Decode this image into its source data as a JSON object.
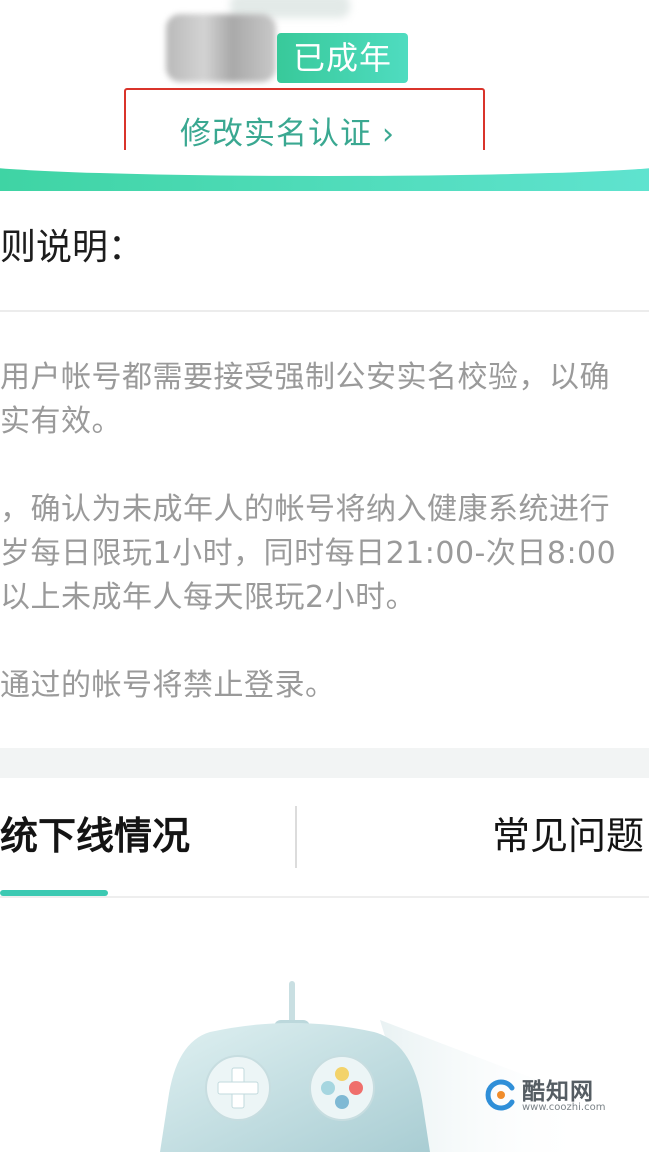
{
  "header": {
    "status_badge": "已成年",
    "modify_link": "修改实名认证",
    "modify_chevron": "›"
  },
  "rules": {
    "heading": "则说明：",
    "lines": [
      "用户帐号都需要接受强制公安实名校验，以确",
      "实有效。",
      "，确认为未成年人的帐号将纳入健康系统进行",
      "岁每日限玩1小时，同时每日21:00-次日8:00",
      "以上未成年人每天限玩2小时。",
      "通过的帐号将禁止登录。"
    ]
  },
  "tabs": {
    "left": "统下线情况",
    "right": "常见问题"
  },
  "illustration": {
    "icon": "game-controller-icon"
  },
  "watermark": {
    "name": "酷知网",
    "url": "www.coozhi.com"
  },
  "colors": {
    "accent_green": "#3aa891",
    "badge_green": "#38c99a",
    "tab_underline": "#3cc9b2",
    "highlight_red": "#d9342b"
  }
}
